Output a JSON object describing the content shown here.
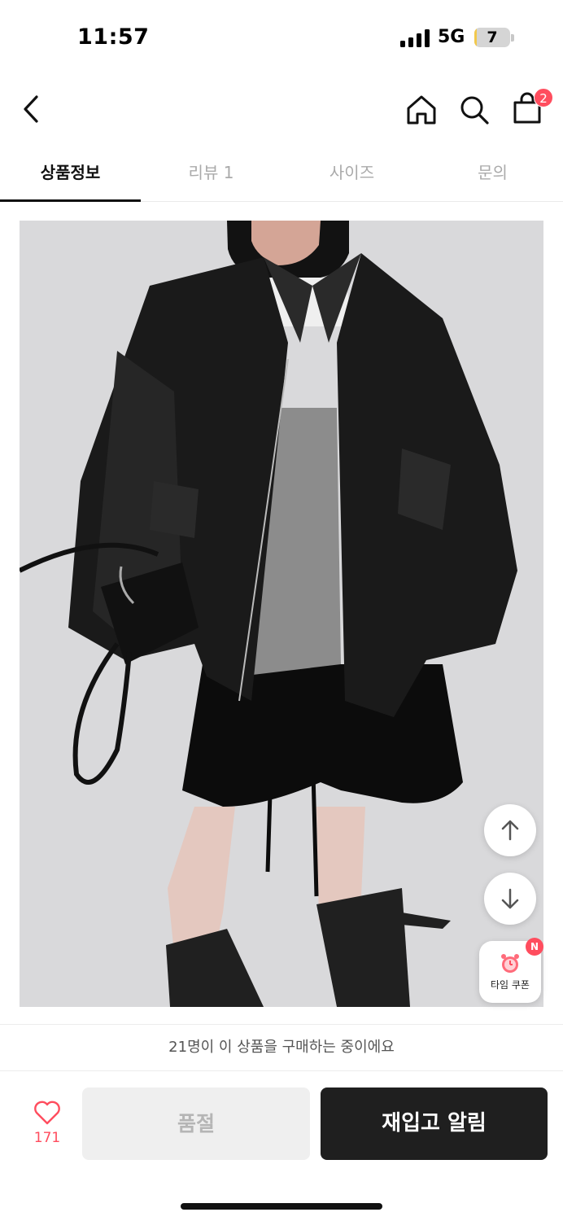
{
  "status_bar": {
    "time": "11:57",
    "network": "5G",
    "battery_level": "7",
    "battery_fraction": 0.07
  },
  "nav": {
    "icons": [
      "chevron-left-icon",
      "home-icon",
      "search-icon",
      "shopping-bag-icon"
    ],
    "cart_count": "2"
  },
  "tabs": [
    {
      "label": "상품정보",
      "active": true
    },
    {
      "label": "리뷰 1",
      "active": false
    },
    {
      "label": "사이즈",
      "active": false
    },
    {
      "label": "문의",
      "active": false
    }
  ],
  "floating": {
    "coupon_label": "타임 쿠폰",
    "coupon_badge": "N"
  },
  "notice": "21명이 이 상품을 구매하는 중이에요",
  "actions": {
    "like_count": "171",
    "soldout_label": "품절",
    "restock_label": "재입고 알림"
  },
  "colors": {
    "accent": "#ff4d5e",
    "primary_button": "#1f1f1f",
    "disabled_button": "#efefef"
  }
}
